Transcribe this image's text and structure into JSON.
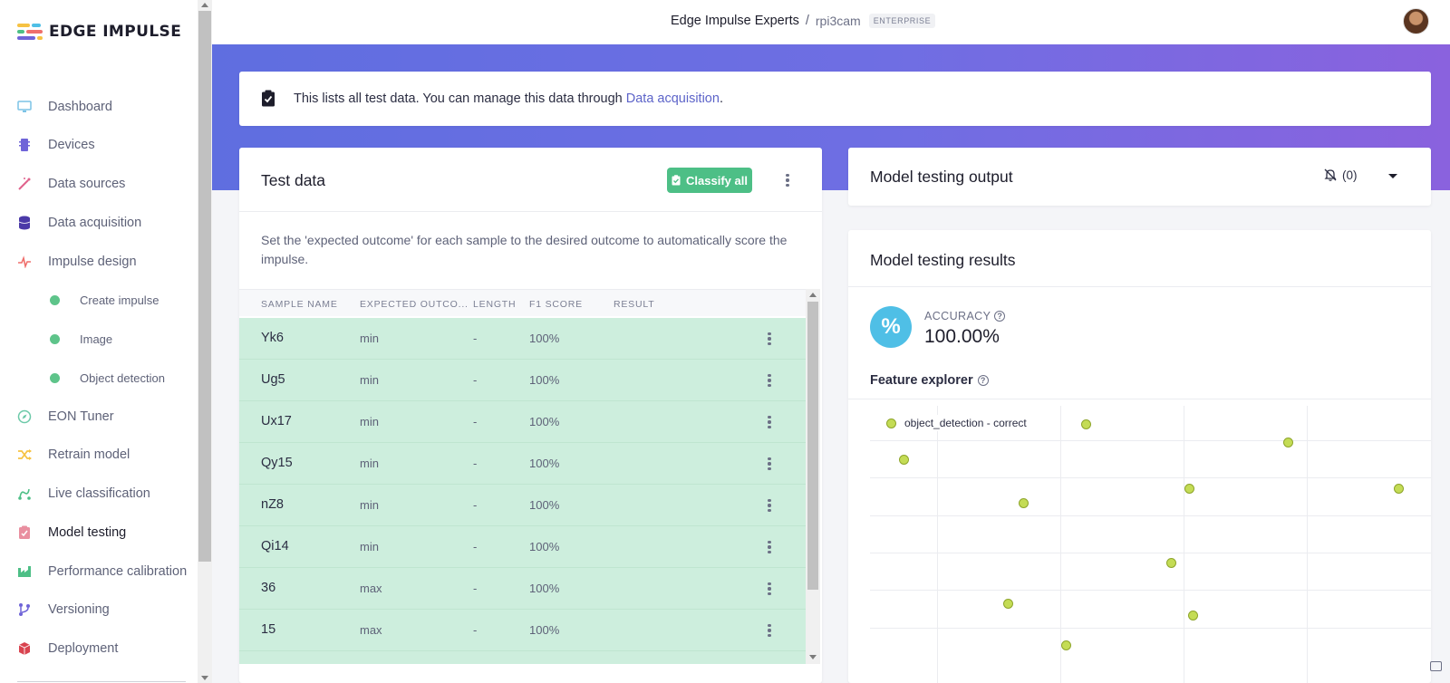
{
  "brand": {
    "name": "EDGE IMPULSE"
  },
  "sidebar": {
    "items": [
      {
        "label": "Dashboard",
        "icon": "monitor-icon"
      },
      {
        "label": "Devices",
        "icon": "chip-icon"
      },
      {
        "label": "Data sources",
        "icon": "wand-icon"
      },
      {
        "label": "Data acquisition",
        "icon": "database-icon"
      },
      {
        "label": "Impulse design",
        "icon": "pulse-icon"
      },
      {
        "label": "Create impulse",
        "icon": "dot-icon"
      },
      {
        "label": "Image",
        "icon": "dot-icon"
      },
      {
        "label": "Object detection",
        "icon": "dot-icon"
      },
      {
        "label": "EON Tuner",
        "icon": "compass-icon"
      },
      {
        "label": "Retrain model",
        "icon": "shuffle-icon"
      },
      {
        "label": "Live classification",
        "icon": "route-icon"
      },
      {
        "label": "Model testing",
        "icon": "clipboard-icon"
      },
      {
        "label": "Performance calibration",
        "icon": "factory-icon"
      },
      {
        "label": "Versioning",
        "icon": "branch-icon"
      },
      {
        "label": "Deployment",
        "icon": "box-icon"
      }
    ]
  },
  "header": {
    "org": "Edge Impulse Experts",
    "separator": "/",
    "project": "rpi3cam",
    "badge": "ENTERPRISE"
  },
  "banner": {
    "text": "This lists all test data. You can manage this data through ",
    "link": "Data acquisition",
    "suffix": "."
  },
  "test_data": {
    "title": "Test data",
    "classify_all": "Classify all",
    "description": "Set the 'expected outcome' for each sample to the desired outcome to automatically score the impulse.",
    "columns": [
      "SAMPLE NAME",
      "EXPECTED OUTCO...",
      "LENGTH",
      "F1 SCORE",
      "RESULT"
    ],
    "rows": [
      {
        "name": "Yk6",
        "expected": "min",
        "length": "-",
        "f1": "100%"
      },
      {
        "name": "Ug5",
        "expected": "min",
        "length": "-",
        "f1": "100%"
      },
      {
        "name": "Ux17",
        "expected": "min",
        "length": "-",
        "f1": "100%"
      },
      {
        "name": "Qy15",
        "expected": "min",
        "length": "-",
        "f1": "100%"
      },
      {
        "name": "nZ8",
        "expected": "min",
        "length": "-",
        "f1": "100%"
      },
      {
        "name": "Qi14",
        "expected": "min",
        "length": "-",
        "f1": "100%"
      },
      {
        "name": "36",
        "expected": "max",
        "length": "-",
        "f1": "100%"
      },
      {
        "name": "15",
        "expected": "max",
        "length": "-",
        "f1": "100%"
      }
    ]
  },
  "output": {
    "title": "Model testing output",
    "notification_count": "(0)"
  },
  "results": {
    "title": "Model testing results",
    "accuracy_icon": "%",
    "accuracy_label": "ACCURACY",
    "accuracy_value": "100.00%",
    "feature_explorer": "Feature explorer",
    "legend": "object_detection - correct",
    "point_color": "#c4dc55"
  },
  "colors": {
    "accent": "#5d64c9",
    "success": "#4dbf86",
    "row_correct": "#cdeedd",
    "accuracy": "#4fbfe6"
  }
}
